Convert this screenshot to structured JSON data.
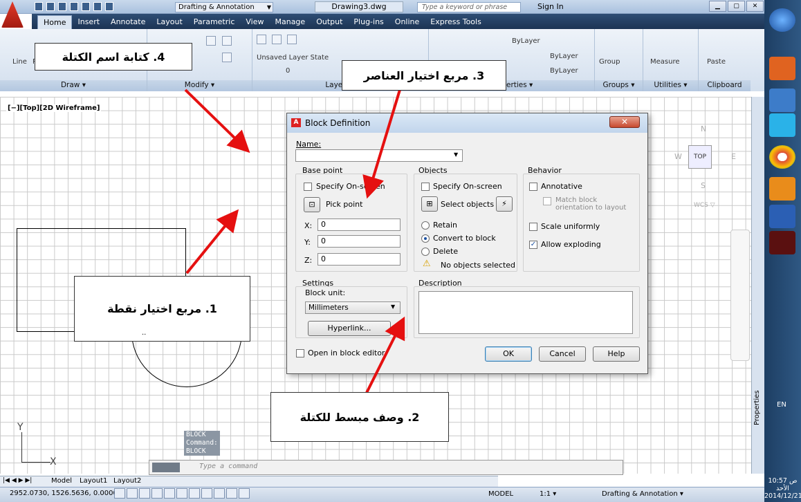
{
  "app": {
    "workspace": "Drafting & Annotation",
    "doc_title": "Drawing3.dwg",
    "search_placeholder": "Type a keyword or phrase",
    "signin": "Sign In"
  },
  "ribbon_tabs": [
    "Home",
    "Insert",
    "Annotate",
    "Layout",
    "Parametric",
    "View",
    "Manage",
    "Output",
    "Plug-ins",
    "Online",
    "Express Tools"
  ],
  "ribbon": {
    "draw": "Draw ▾",
    "modify": "Modify ▾",
    "layers": "Layers ▾",
    "properties": "Properties ▾",
    "groups": "Groups ▾",
    "utilities": "Utilities ▾",
    "clipboard": "Clipboard",
    "line": "Line",
    "p": "P",
    "unsaved_layer": "Unsaved Layer State",
    "bylayer1": "ByLayer",
    "bylayer2": "ByLayer",
    "bylayer3": "ByLayer",
    "group": "Group",
    "measure": "Measure",
    "paste": "Paste",
    "layer_num": "0"
  },
  "viewport": {
    "label": "[−][Top][2D Wireframe]",
    "y_axis": "Y",
    "x_axis": "X",
    "viewcube_top": "TOP",
    "n": "N",
    "s": "S",
    "e": "E",
    "w": "W",
    "wcs": "WCS ▽"
  },
  "command": {
    "hist1": "BLOCK",
    "hist2": "Command:",
    "hist3": "BLOCK",
    "placeholder": "Type a command"
  },
  "layout_tabs": [
    "Model",
    "Layout1",
    "Layout2"
  ],
  "status": {
    "coords": "2952.0730, 1526.5636, 0.0000",
    "model": "MODEL",
    "scale": "1:1 ▾",
    "workspace": "Drafting & Annotation ▾"
  },
  "right_panel": {
    "properties": "Properties"
  },
  "dialog": {
    "title": "Block Definition",
    "name_label": "Name:",
    "name_value": "",
    "base_point": "Base point",
    "specify_onscreen_bp": "Specify On-screen",
    "pick_point": "Pick point",
    "x_label": "X:",
    "y_label": "Y:",
    "z_label": "Z:",
    "x_val": "0",
    "y_val": "0",
    "z_val": "0",
    "objects": "Objects",
    "specify_onscreen_obj": "Specify On-screen",
    "select_objects": "Select objects",
    "retain": "Retain",
    "convert": "Convert to block",
    "delete": "Delete",
    "no_objects": "No objects selected",
    "behavior": "Behavior",
    "annotative": "Annotative",
    "match_orient": "Match block orientation to layout",
    "scale_uniform": "Scale uniformly",
    "allow_exploding": "Allow exploding",
    "settings": "Settings",
    "block_unit": "Block unit:",
    "unit_value": "Millimeters",
    "hyperlink": "Hyperlink...",
    "description": "Description",
    "open_in_editor": "Open in block editor",
    "ok": "OK",
    "cancel": "Cancel",
    "help": "Help"
  },
  "annotations": {
    "a1": "1. مربع اختيار نقطة",
    "a2": "2. وصف مبسط للكتلة",
    "a3": "3. مربع اختيار العناصر",
    "a4": "4. كتابة اسم الكتلة",
    "a1_extra": ".."
  },
  "taskbar": {
    "lang": "EN",
    "time": "10:57 ص",
    "day": "الأحد",
    "date": "2014/12/21"
  }
}
